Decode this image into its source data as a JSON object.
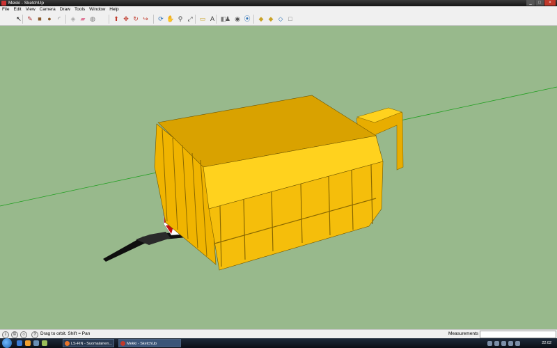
{
  "window": {
    "title": "Mekki - SketchUp"
  },
  "menu": [
    "File",
    "Edit",
    "View",
    "Camera",
    "Draw",
    "Tools",
    "Window",
    "Help"
  ],
  "toolbar": {
    "tools": [
      {
        "name": "select-icon",
        "glyph": "↖",
        "color": "#000000"
      },
      {
        "name": "pencil-icon",
        "glyph": "✎",
        "color": "#b03030"
      },
      {
        "name": "rectangle-icon",
        "glyph": "■",
        "color": "#8a5a2b"
      },
      {
        "name": "circle-icon",
        "glyph": "●",
        "color": "#8a5a2b"
      },
      {
        "name": "arc-icon",
        "glyph": "◜",
        "color": "#555555"
      },
      {
        "name": "make-component-icon",
        "glyph": "◈",
        "color": "#aaaaaa"
      },
      {
        "name": "eraser-icon",
        "glyph": "▰",
        "color": "#e07a9a"
      },
      {
        "name": "paint-bucket-icon",
        "glyph": "◍",
        "color": "#777777"
      },
      {
        "name": "push-pull-icon",
        "glyph": "⬆",
        "color": "#c0392b"
      },
      {
        "name": "move-icon",
        "glyph": "✥",
        "color": "#c0392b"
      },
      {
        "name": "rotate-icon",
        "glyph": "↻",
        "color": "#c0392b"
      },
      {
        "name": "follow-me-icon",
        "glyph": "↪",
        "color": "#c0392b"
      },
      {
        "name": "orbit-icon",
        "glyph": "⟳",
        "color": "#2a6fb5"
      },
      {
        "name": "pan-icon",
        "glyph": "✋",
        "color": "#444444"
      },
      {
        "name": "zoom-icon",
        "glyph": "⚲",
        "color": "#444444"
      },
      {
        "name": "zoom-extents-icon",
        "glyph": "⤢",
        "color": "#444444"
      },
      {
        "name": "tape-measure-icon",
        "glyph": "▭",
        "color": "#c9a227"
      },
      {
        "name": "text-icon",
        "glyph": "A",
        "color": "#333333"
      },
      {
        "name": "section-plane-icon",
        "glyph": "◧",
        "color": "#777777"
      },
      {
        "name": "walk-icon",
        "glyph": "♟",
        "color": "#555555"
      },
      {
        "name": "look-around-icon",
        "glyph": "◉",
        "color": "#555555"
      },
      {
        "name": "position-camera-icon",
        "glyph": "⦿",
        "color": "#2a6fb5"
      },
      {
        "name": "get-models-icon",
        "glyph": "◆",
        "color": "#c9a227"
      },
      {
        "name": "share-model-icon",
        "glyph": "◆",
        "color": "#c9a227"
      },
      {
        "name": "share-component-icon",
        "glyph": "◇",
        "color": "#2a6fb5"
      },
      {
        "name": "google-earth-icon",
        "glyph": "□",
        "color": "#777777"
      }
    ]
  },
  "status": {
    "hint": "Drag to orbit.  Shift = Pan",
    "measurements_label": "Measurements",
    "measurements_value": ""
  },
  "taskbar": {
    "tasks": [
      {
        "label": "LS-FIN - Suomalainen...",
        "icon_color": "#e8742a"
      },
      {
        "label": "Mekki - SketchUp",
        "icon_color": "#c0392b"
      }
    ],
    "clock": "22:02"
  },
  "colors": {
    "viewport": "#98b98c",
    "model_yellow": "#f5be0b",
    "model_top": "#ffd21e",
    "model_dark": "#cf9a00",
    "axis_green": "#1f9f1f"
  }
}
